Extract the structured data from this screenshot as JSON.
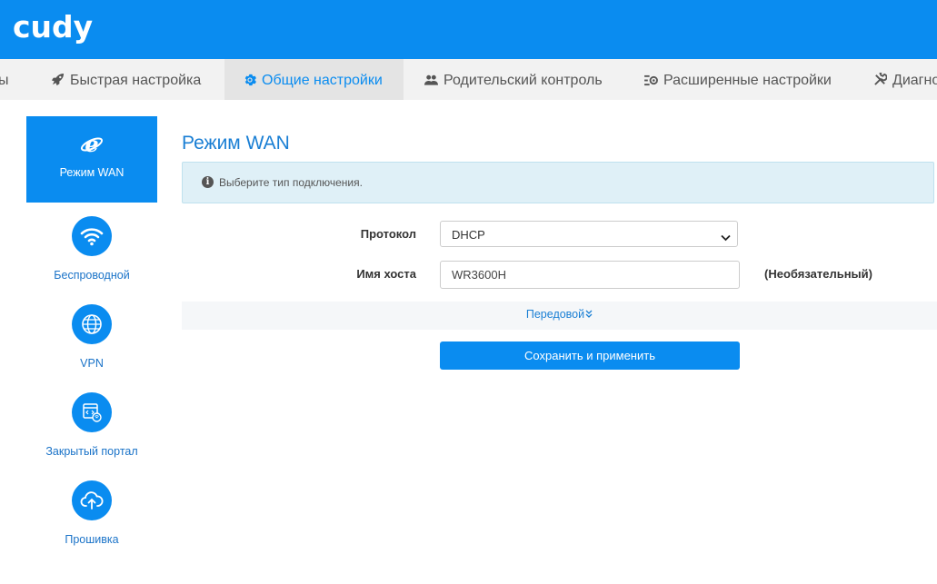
{
  "header": {
    "logo": "cudy"
  },
  "nav": {
    "items": [
      {
        "label": "ы",
        "icon": "dashboard-icon"
      },
      {
        "label": "Быстрая настройка",
        "icon": "rocket-icon"
      },
      {
        "label": "Общие настройки",
        "icon": "gear-icon",
        "active": true
      },
      {
        "label": "Родительский контроль",
        "icon": "users-icon"
      },
      {
        "label": "Расширенные настройки",
        "icon": "advanced-settings-icon"
      },
      {
        "label": "Диагно",
        "icon": "tools-icon"
      }
    ]
  },
  "sidebar": {
    "items": [
      {
        "label": "Режим WAN",
        "icon": "wan-icon",
        "active": true
      },
      {
        "label": "Беспроводной",
        "icon": "wifi-icon"
      },
      {
        "label": "VPN",
        "icon": "globe-icon"
      },
      {
        "label": "Закрытый портал",
        "icon": "portal-icon"
      },
      {
        "label": "Прошивка",
        "icon": "cloud-upload-icon"
      }
    ]
  },
  "main": {
    "title": "Режим WAN",
    "info_text": "Выберите тип подключения.",
    "form": {
      "protocol_label": "Протокол",
      "protocol_value": "DHCP",
      "hostname_label": "Имя хоста",
      "hostname_value": "WR3600H",
      "hostname_hint": "(Необязательный)"
    },
    "advanced_label": "Передовой",
    "advanced_chevron": "»",
    "save_label": "Сохранить и применить"
  },
  "colors": {
    "accent": "#0a8cf0",
    "nav_bg": "#f2f2f2",
    "info_bg": "#dff0f7"
  }
}
